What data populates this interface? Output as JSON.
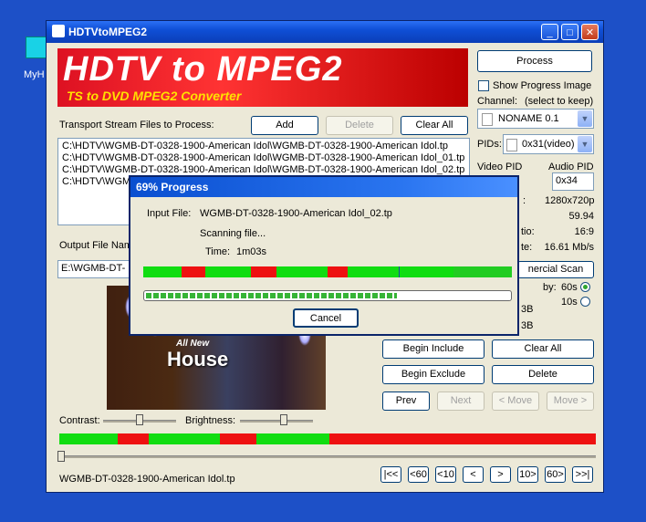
{
  "desktop": {
    "icon_label": "MyH"
  },
  "window": {
    "title": "HDTVtoMPEG2",
    "banner_title": "HDTV to MPEG2",
    "banner_subtitle": "TS to DVD MPEG2 Converter"
  },
  "files": {
    "label": "Transport Stream Files to Process:",
    "add": "Add",
    "delete": "Delete",
    "clear_all": "Clear All",
    "items": [
      "C:\\HDTV\\WGMB-DT-0328-1900-American Idol\\WGMB-DT-0328-1900-American Idol.tp",
      "C:\\HDTV\\WGMB-DT-0328-1900-American Idol\\WGMB-DT-0328-1900-American Idol_01.tp",
      "C:\\HDTV\\WGMB-DT-0328-1900-American Idol\\WGMB-DT-0328-1900-American Idol_02.tp",
      "C:\\HDTV\\WGM"
    ]
  },
  "output": {
    "label": "Output File Nam",
    "value": "E:\\WGMB-DT-"
  },
  "right": {
    "process": "Process",
    "show_progress": "Show Progress Image",
    "channel_label": "Channel:",
    "channel_hint": "(select to keep)",
    "channel_value": "NONAME 0.1",
    "pids_label": "PIDs:",
    "pids_value": "0x31(video)",
    "video_pid_label": "Video PID",
    "audio_pid_label": "Audio PID",
    "audio_pid_value": "0x34",
    "info_labels": [
      ":",
      "",
      "tio:",
      "te:"
    ],
    "info_values": [
      "1280x720p",
      "59.94",
      "16:9",
      "16.61 Mb/s"
    ],
    "commercial_scan": "nercial Scan",
    "by_label": "by:",
    "opt_60s": "60s",
    "opt_10s": "10s",
    "size1": "3B",
    "size2": "3B",
    "begin_include": "Begin Include",
    "clear_all": "Clear All",
    "begin_exclude": "Begin Exclude",
    "delete": "Delete",
    "prev": "Prev",
    "next": "Next",
    "move_left": "< Move",
    "move_right": "Move >"
  },
  "preview": {
    "all_new": "All New",
    "house": "House"
  },
  "adjust": {
    "contrast": "Contrast:",
    "brightness": "Brightness:"
  },
  "bottom": {
    "filename": "WGMB-DT-0328-1900-American Idol.tp",
    "nav": [
      "|<<",
      "<60",
      "<10",
      "<",
      ">",
      "10>",
      "60>",
      ">>|"
    ]
  },
  "dialog": {
    "title": "69% Progress",
    "input_label": "Input File:",
    "input_value": "WGMB-DT-0328-1900-American Idol_02.tp",
    "status": "Scanning file...",
    "time_label": "Time:",
    "time_value": "1m03s",
    "progress": 0.69,
    "cancel": "Cancel"
  },
  "colors": {
    "green": "#11dd11",
    "red": "#ee1111",
    "titlebar": "#0b4fd4"
  }
}
